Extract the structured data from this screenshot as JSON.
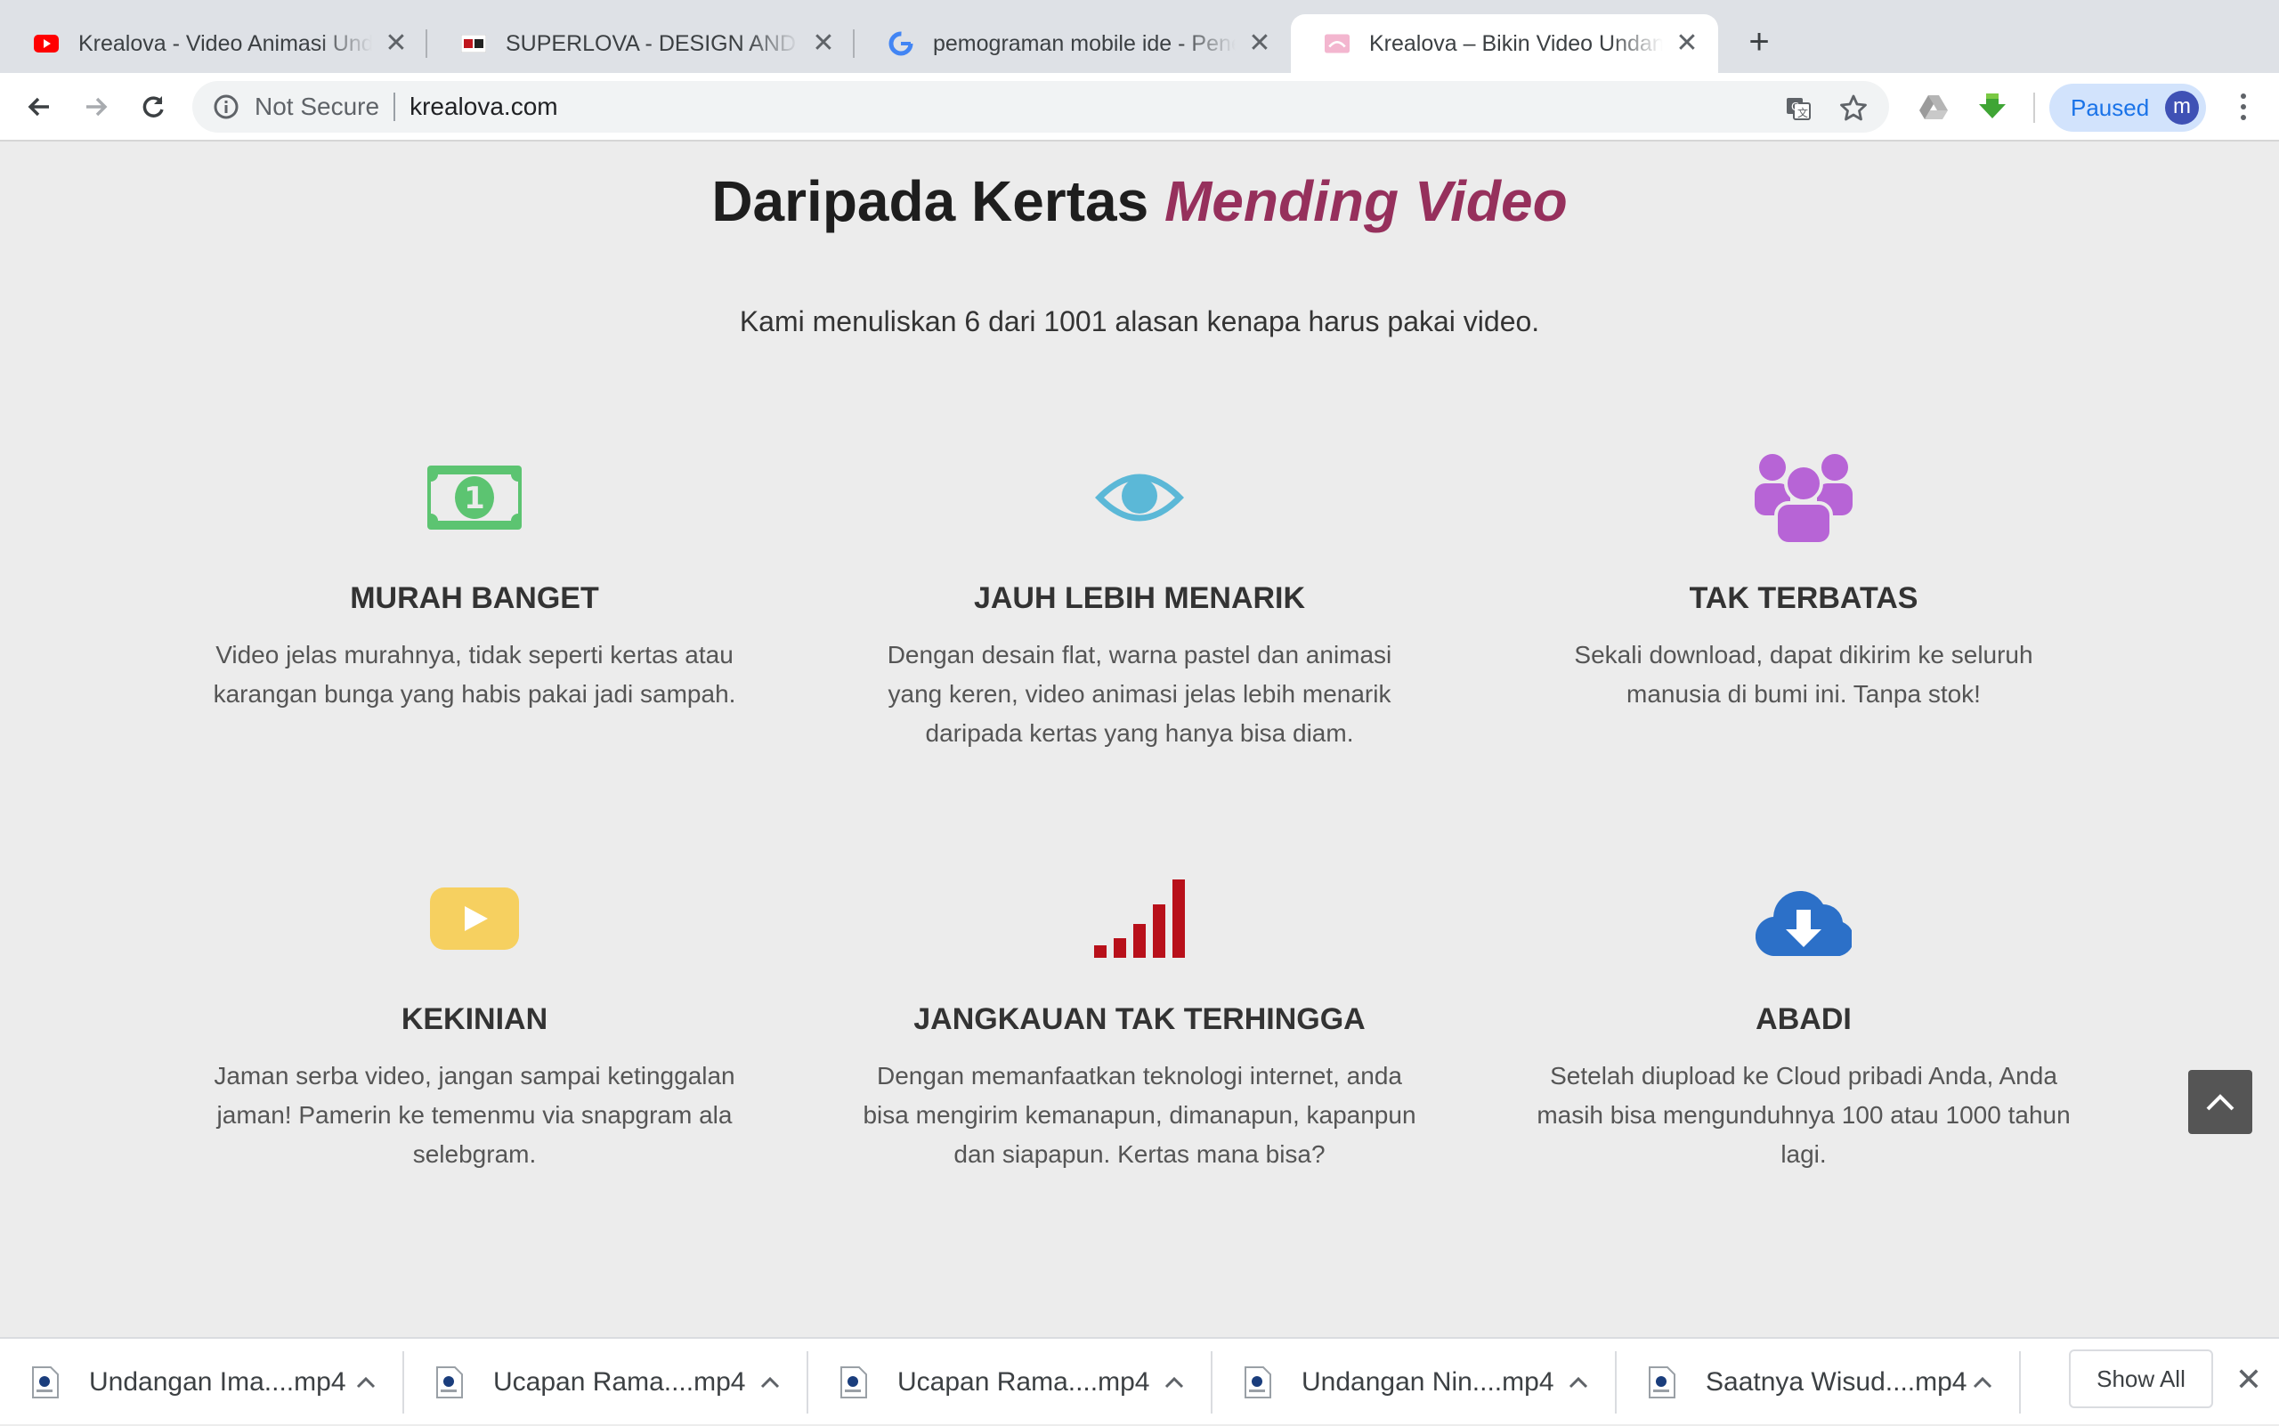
{
  "browser": {
    "tabs": [
      {
        "title": "Krealova - Video Animasi Undangan",
        "favicon": "youtube-icon",
        "close": "✕"
      },
      {
        "title": "SUPERLOVA - DESIGN AND CREATIVE",
        "favicon": "superlova-icon",
        "close": "✕"
      },
      {
        "title": "pemograman mobile ide - Penelusuran Google",
        "favicon": "google-icon",
        "close": "✕"
      },
      {
        "title": "Krealova – Bikin Video Undangan",
        "favicon": "krealova-icon",
        "close": "✕",
        "active": true
      }
    ],
    "new_tab": "+",
    "omnibox": {
      "security": "Not Secure",
      "url": "krealova.com"
    },
    "profile": {
      "label": "Paused",
      "avatar_letter": "m"
    }
  },
  "page": {
    "headline": {
      "plain": "Daripada Kertas ",
      "emphasis": "Mending Video"
    },
    "subtitle": "Kami menuliskan 6 dari 1001 alasan kenapa harus pakai video.",
    "features": [
      {
        "icon": "money-icon",
        "color": "#5cc471",
        "title": "MURAH BANGET",
        "text": "Video jelas murahnya, tidak seperti kertas atau karangan bunga yang habis pakai jadi sampah."
      },
      {
        "icon": "eye-icon",
        "color": "#5bb8d7",
        "title": "JAUH LEBIH MENARIK",
        "text": "Dengan desain flat, warna pastel dan animasi yang keren, video animasi jelas lebih menarik daripada kertas yang hanya bisa diam."
      },
      {
        "icon": "users-icon",
        "color": "#b764d6",
        "title": "TAK TERBATAS",
        "text": "Sekali download, dapat dikirim ke seluruh manusia di bumi ini. Tanpa stok!"
      },
      {
        "icon": "play-icon",
        "color": "#f6d060",
        "title": "KEKINIAN",
        "text": "Jaman serba video, jangan sampai ketinggalan jaman! Pamerin ke temenmu via snapgram ala selebgram."
      },
      {
        "icon": "signal-icon",
        "color": "#b8101a",
        "title": "JANGKAUAN TAK TERHINGGA",
        "text": "Dengan memanfaatkan teknologi internet, anda bisa mengirim kemanapun, dimanapun, kapanpun dan siapapun. Kertas mana bisa?"
      },
      {
        "icon": "cloud-download-icon",
        "color": "#2c70c8",
        "title": "ABADI",
        "text": "Setelah diupload ke Cloud pribadi Anda, Anda masih bisa mengunduhnya 100 atau 1000 tahun lagi."
      }
    ]
  },
  "downloads": {
    "items": [
      {
        "name": "Undangan Ima....mp4"
      },
      {
        "name": "Ucapan Rama....mp4"
      },
      {
        "name": "Ucapan Rama....mp4"
      },
      {
        "name": "Undangan Nin....mp4"
      },
      {
        "name": "Saatnya Wisud....mp4"
      }
    ],
    "show_all": "Show All",
    "close": "✕"
  }
}
